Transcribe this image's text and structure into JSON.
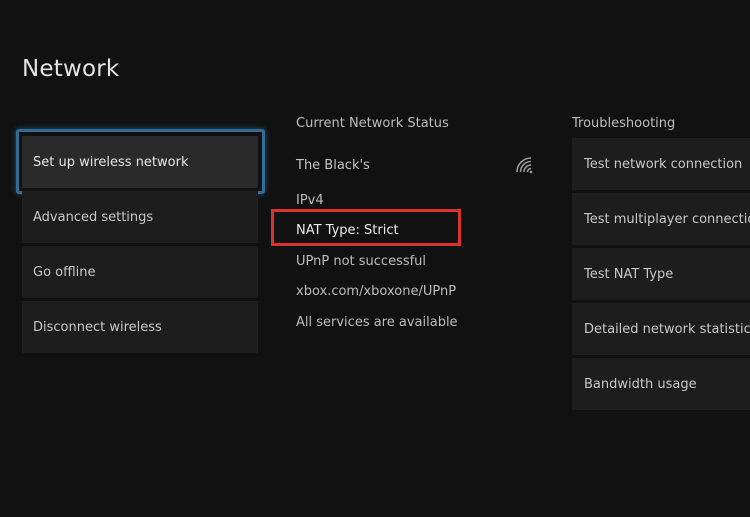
{
  "page": {
    "title": "Network"
  },
  "menu": {
    "items": [
      {
        "label": "Set up wireless network"
      },
      {
        "label": "Advanced settings"
      },
      {
        "label": "Go offline"
      },
      {
        "label": "Disconnect wireless"
      }
    ],
    "focused_index": 0
  },
  "status": {
    "heading": "Current Network Status",
    "network_name": "The Black's",
    "network_icon": "wifi-signal-icon",
    "ip_version": "IPv4",
    "nat_type": "NAT Type: Strict",
    "upnp": "UPnP not successful",
    "upnp_link": "xbox.com/xboxone/UPnP",
    "services": "All services are available"
  },
  "troubleshooting": {
    "heading": "Troubleshooting",
    "items": [
      {
        "label": "Test network connection"
      },
      {
        "label": "Test multiplayer connection"
      },
      {
        "label": "Test NAT Type"
      },
      {
        "label": "Detailed network statistics"
      },
      {
        "label": "Bandwidth usage"
      }
    ]
  },
  "colors": {
    "background": "#111111",
    "focus_ring": "#2f6d96",
    "nat_highlight": "#d9342b",
    "tile": "#1d1d1d"
  }
}
